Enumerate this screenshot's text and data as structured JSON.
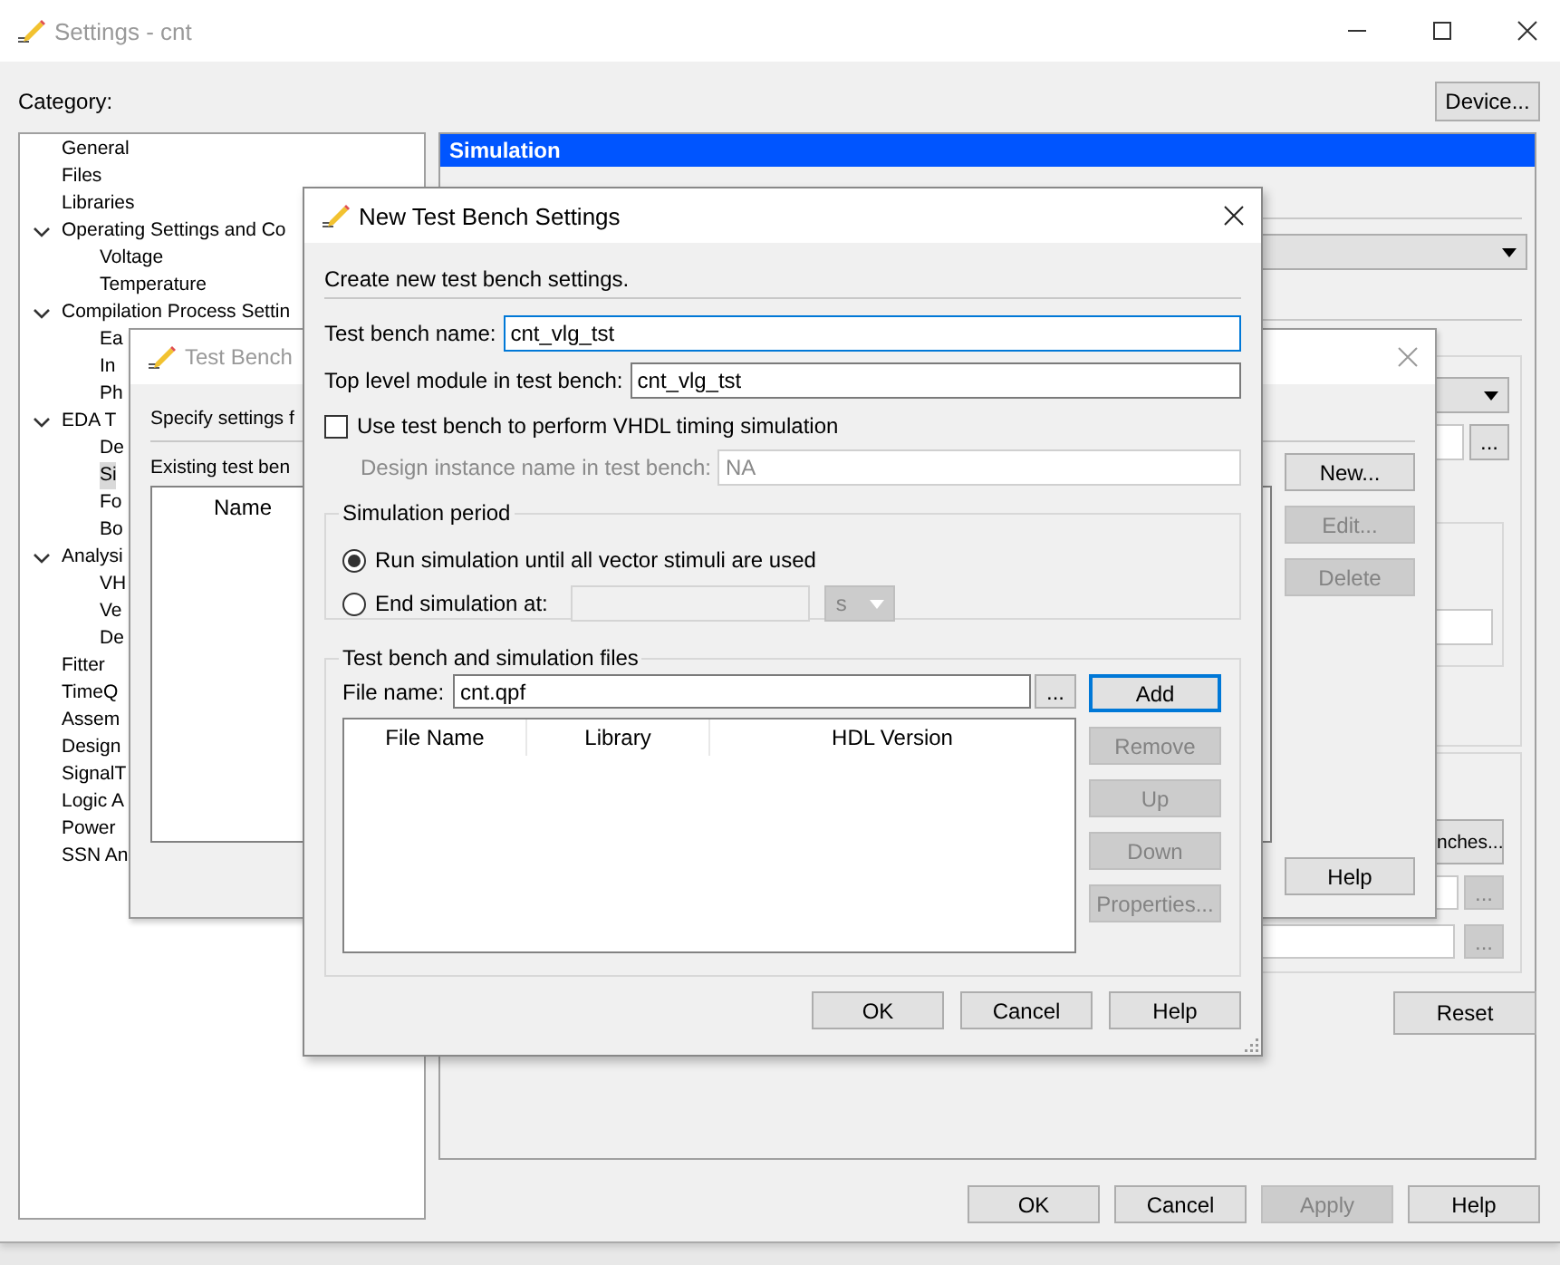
{
  "settings_window": {
    "title": "Settings - cnt",
    "active": false,
    "category_label": "Category:",
    "device_button": "Device...",
    "category_tree": [
      {
        "label": "General",
        "selected": false
      },
      {
        "label": "Files",
        "selected": false
      },
      {
        "label": "Libraries",
        "selected": false
      },
      {
        "label": "Operating Settings and Co",
        "selected": false,
        "expanded": true,
        "children": [
          {
            "label": "Voltage",
            "selected": false
          },
          {
            "label": "Temperature",
            "selected": false
          }
        ]
      },
      {
        "label": "Compilation Process Settin",
        "selected": false,
        "expanded": true,
        "children": [
          {
            "label": "Ea",
            "selected": false
          },
          {
            "label": "In",
            "selected": false
          },
          {
            "label": "Ph",
            "selected": false
          }
        ]
      },
      {
        "label": "EDA T",
        "selected": false,
        "expanded": true,
        "children": [
          {
            "label": "De",
            "selected": false
          },
          {
            "label": "Si",
            "selected": true
          },
          {
            "label": "Fo",
            "selected": false
          },
          {
            "label": "Bo",
            "selected": false
          }
        ]
      },
      {
        "label": "Analysi",
        "selected": false,
        "expanded": true,
        "children": [
          {
            "label": "VH",
            "selected": false
          },
          {
            "label": "Ve",
            "selected": false
          },
          {
            "label": "De",
            "selected": false
          }
        ]
      },
      {
        "label": "Fitter",
        "selected": false
      },
      {
        "label": "TimeQ",
        "selected": false
      },
      {
        "label": "Assem",
        "selected": false
      },
      {
        "label": "Design",
        "selected": false
      },
      {
        "label": "SignalT",
        "selected": false
      },
      {
        "label": "Logic A",
        "selected": false
      },
      {
        "label": "Power",
        "selected": false
      },
      {
        "label": "SSN An",
        "selected": false
      }
    ],
    "panel": {
      "header": "Simulation",
      "browse_buttons": [
        "...",
        "...",
        "..."
      ],
      "launch_button": "nches...",
      "reset_button": "Reset"
    },
    "buttons": [
      {
        "label": "OK",
        "disabled": false
      },
      {
        "label": "Cancel",
        "disabled": false
      },
      {
        "label": "Apply",
        "disabled": true
      },
      {
        "label": "Help",
        "disabled": false
      }
    ]
  },
  "test_benches_dialog": {
    "title": "Test Bench",
    "active": false,
    "intro": "Specify settings f",
    "list_label": "Existing test ben",
    "list_columns": [
      "Name"
    ],
    "buttons": [
      {
        "label": "New...",
        "disabled": false
      },
      {
        "label": "Edit...",
        "disabled": true
      },
      {
        "label": "Delete",
        "disabled": true
      }
    ],
    "help_button": "Help"
  },
  "new_test_bench_dialog": {
    "title": "New Test Bench Settings",
    "active": true,
    "intro": "Create new test bench settings.",
    "test_bench_name": {
      "label": "Test bench name:",
      "value": "cnt_vlg_tst",
      "focused": true
    },
    "top_level_module": {
      "label": "Top level module in test bench:",
      "value": "cnt_vlg_tst",
      "focused": false
    },
    "vhdl_timing": {
      "label": "Use test bench to perform VHDL timing simulation",
      "checked": false
    },
    "design_instance": {
      "label": "Design instance name in test bench:",
      "value": "NA",
      "disabled": true
    },
    "simulation_period": {
      "title": "Simulation period",
      "options": [
        {
          "label": "Run simulation until all vector stimuli are used",
          "selected": true
        },
        {
          "label": "End simulation at:",
          "selected": false
        }
      ],
      "unit": "s",
      "disabled": true
    },
    "files": {
      "title": "Test bench and simulation files",
      "file_label": "File name:",
      "file_value": "cnt.qpf",
      "browse": "...",
      "columns": [
        "File Name",
        "Library",
        "HDL Version"
      ],
      "buttons": [
        {
          "label": "Add",
          "disabled": false,
          "focused": true
        },
        {
          "label": "Remove",
          "disabled": true,
          "focused": false
        },
        {
          "label": "Up",
          "disabled": true,
          "focused": false
        },
        {
          "label": "Down",
          "disabled": true,
          "focused": false
        },
        {
          "label": "Properties...",
          "disabled": true,
          "focused": false
        }
      ]
    },
    "buttons": [
      {
        "label": "OK",
        "disabled": false
      },
      {
        "label": "Cancel",
        "disabled": false
      },
      {
        "label": "Help",
        "disabled": false
      }
    ]
  }
}
